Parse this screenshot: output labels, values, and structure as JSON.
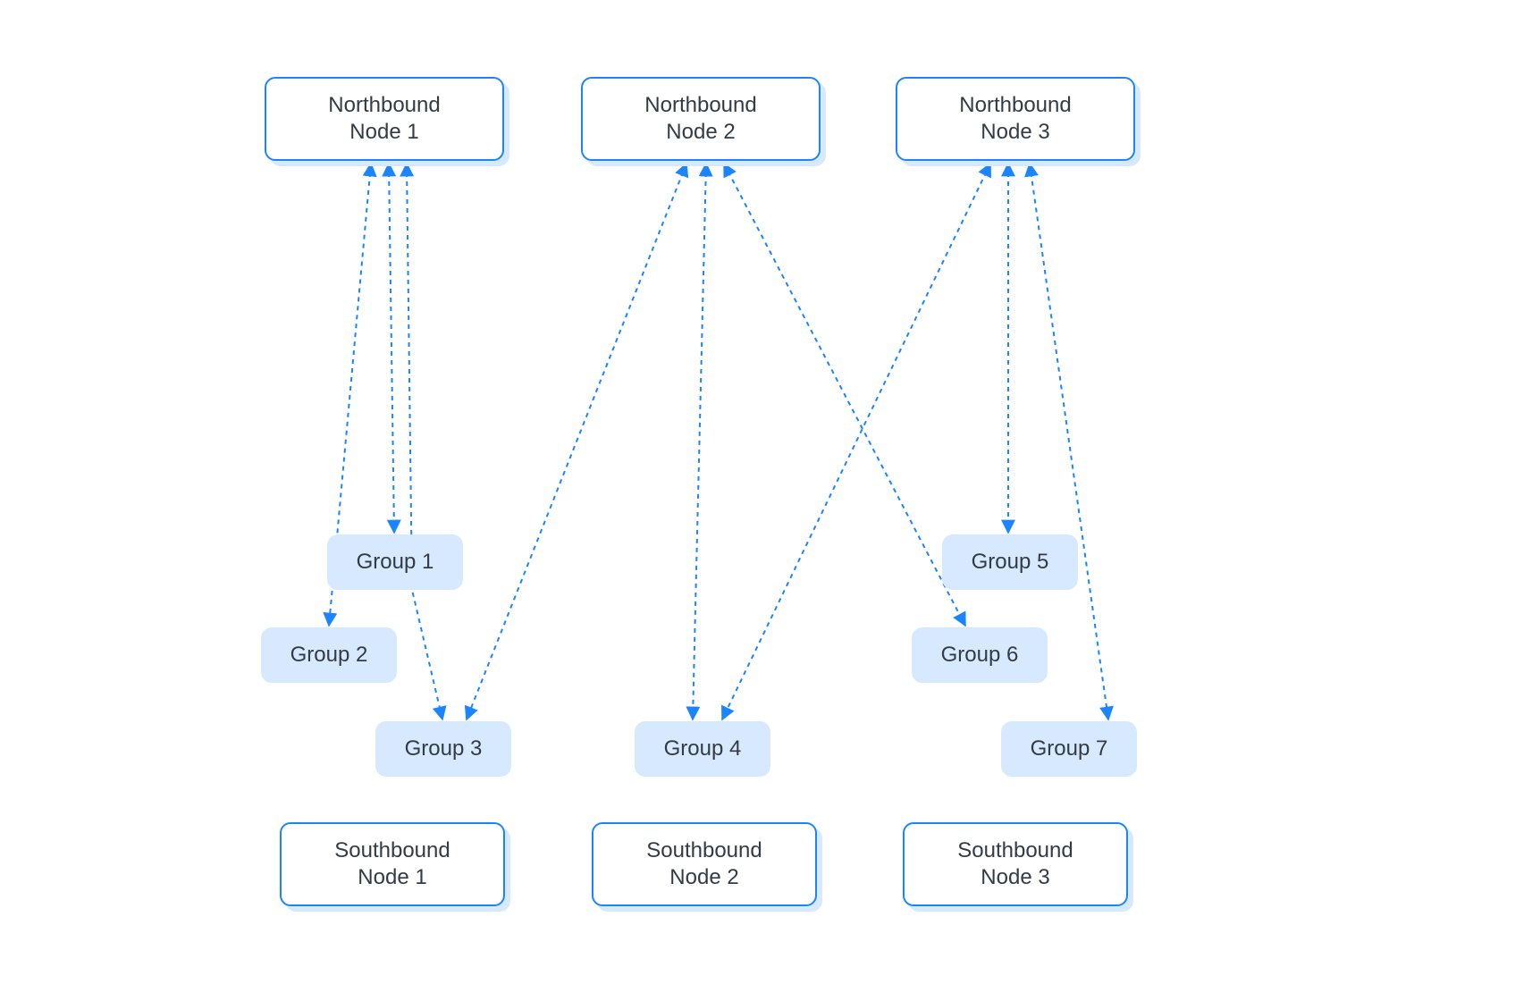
{
  "colors": {
    "stroke": "#1b84ff",
    "shadow": "#d7e9ff",
    "groupFill": "#d7e9ff",
    "text": "#333b45"
  },
  "northbound": [
    {
      "line1": "Northbound",
      "line2": "Node 1"
    },
    {
      "line1": "Northbound",
      "line2": "Node 2"
    },
    {
      "line1": "Northbound",
      "line2": "Node 3"
    }
  ],
  "southbound": [
    {
      "line1": "Southbound",
      "line2": "Node 1"
    },
    {
      "line1": "Southbound",
      "line2": "Node 2"
    },
    {
      "line1": "Southbound",
      "line2": "Node 3"
    }
  ],
  "groups": [
    {
      "label": "Group 1"
    },
    {
      "label": "Group 2"
    },
    {
      "label": "Group 3"
    },
    {
      "label": "Group 4"
    },
    {
      "label": "Group 5"
    },
    {
      "label": "Group 6"
    },
    {
      "label": "Group 7"
    }
  ]
}
